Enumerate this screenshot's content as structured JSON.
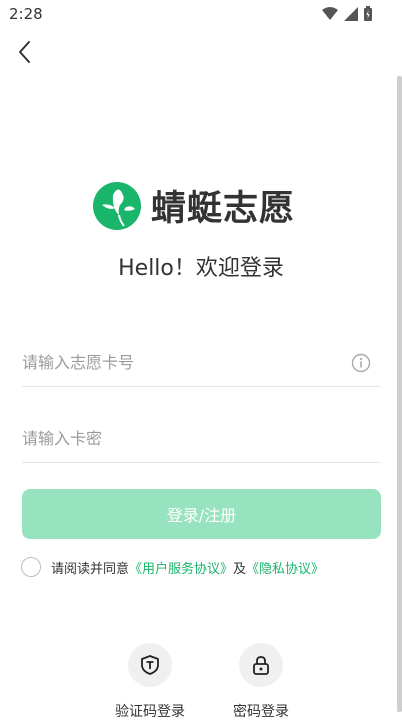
{
  "status_bar": {
    "time": "2:28"
  },
  "brand": {
    "name": "蜻蜓志愿",
    "welcome": "Hello！欢迎登录"
  },
  "form": {
    "card_number_placeholder": "请输入志愿卡号",
    "card_password_placeholder": "请输入卡密",
    "submit_label": "登录/注册"
  },
  "agreement": {
    "prefix": "请阅读并同意",
    "service_link": "《用户服务协议》",
    "joiner": "及",
    "privacy_link": "《隐私协议》"
  },
  "alt_login": [
    {
      "label": "验证码登录",
      "icon": "shield-t-icon"
    },
    {
      "label": "密码登录",
      "icon": "lock-icon"
    }
  ],
  "colors": {
    "brand_green": "#19b56b",
    "button_disabled": "#98e3bf"
  }
}
